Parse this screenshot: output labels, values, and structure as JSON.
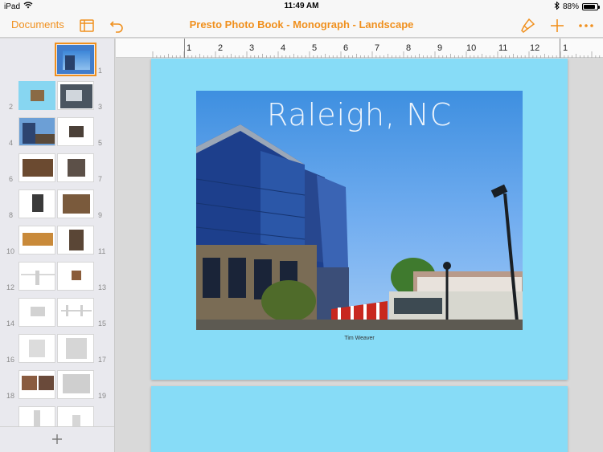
{
  "status": {
    "device": "iPad",
    "time": "11:49 AM",
    "battery": "88%",
    "battery_level": 0.88
  },
  "toolbar": {
    "documents_label": "Documents",
    "title": "Presto Photo Book - Monograph - Landscape",
    "accent": "#f0901e"
  },
  "ruler": {
    "labels": [
      "1",
      "2",
      "3",
      "4",
      "5",
      "6",
      "7",
      "8",
      "9",
      "10",
      "11",
      "12",
      "1"
    ]
  },
  "sidebar": {
    "page_numbers": [
      "1",
      "2",
      "3",
      "4",
      "5",
      "6",
      "7",
      "8",
      "9",
      "10",
      "11",
      "12",
      "13",
      "14",
      "15",
      "16",
      "17",
      "18",
      "19"
    ]
  },
  "page": {
    "title": "Raleigh, NC",
    "caption": "Tim Weaver",
    "background": "#87dcf7"
  }
}
